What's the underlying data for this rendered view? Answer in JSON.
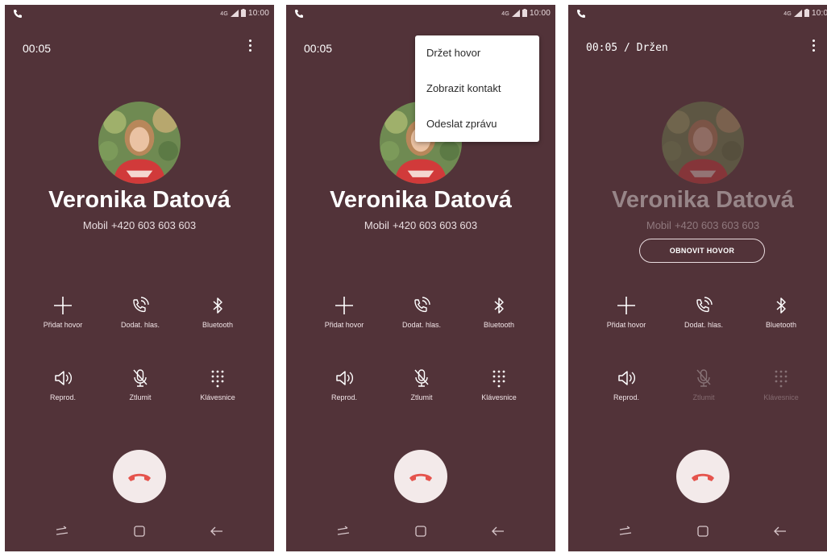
{
  "status": {
    "time": "10:00",
    "net": "4G"
  },
  "contact": {
    "name": "Veronika Datová",
    "number_type": "Mobil",
    "number": "+420 603 603 603"
  },
  "screens": [
    {
      "timer": "00:05"
    },
    {
      "timer": "00:05"
    },
    {
      "timer": "00:05 / Držen"
    }
  ],
  "menu": {
    "items": [
      "Držet hovor",
      "Zobrazit kontakt",
      "Odeslat zprávu"
    ]
  },
  "resume_label": "OBNOVIT HOVOR",
  "buttons": {
    "add": "Přidat hovor",
    "extra": "Dodat. hlas.",
    "bt": "Bluetooth",
    "speaker": "Reprod.",
    "mute": "Ztlumit",
    "keypad": "Klávesnice"
  },
  "colors": {
    "background": "#523339",
    "end_call_icon": "#e5544d",
    "end_call_bg": "#f3eaea"
  },
  "icons": [
    "phone-icon",
    "more-options-icon",
    "plus-icon",
    "add-voice-icon",
    "bluetooth-icon",
    "speaker-icon",
    "mute-icon",
    "keypad-icon",
    "end-call-icon",
    "recent-apps-icon",
    "home-icon",
    "back-icon"
  ]
}
